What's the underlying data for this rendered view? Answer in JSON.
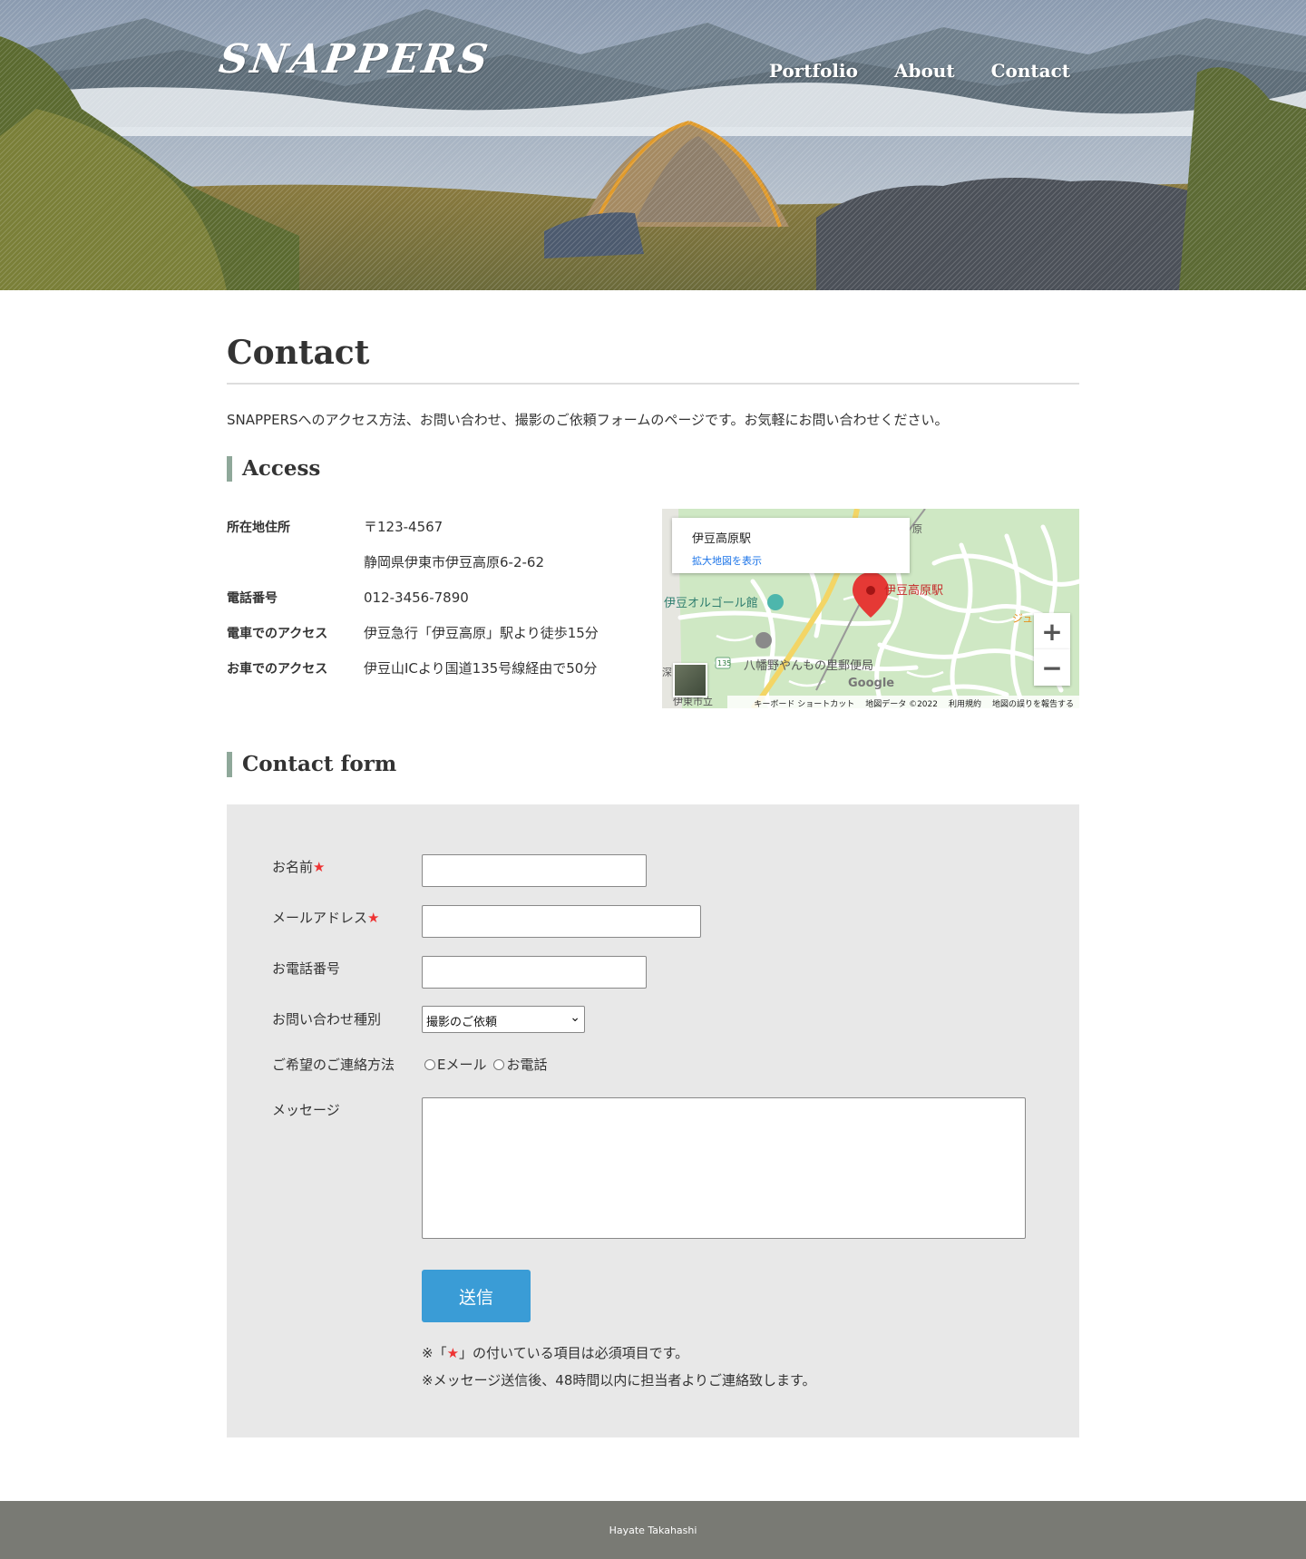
{
  "header": {
    "logo": "SNAPPERS",
    "nav": [
      "Portfolio",
      "About",
      "Contact"
    ]
  },
  "main": {
    "title": "Contact",
    "intro": "SNAPPERSへのアクセス方法、お問い合わせ、撮影のご依頼フォームのページです。お気軽にお問い合わせください。",
    "access": {
      "title": "Access",
      "rows": [
        {
          "key": "所在地住所",
          "value": "〒123-4567"
        },
        {
          "key": "",
          "value": "静岡県伊東市伊豆高原6-2-62"
        },
        {
          "key": "電話番号",
          "value": "012-3456-7890"
        },
        {
          "key": "電車でのアクセス",
          "value": "伊豆急行「伊豆高原」駅より徒歩15分"
        },
        {
          "key": "お車でのアクセス",
          "value": "伊豆山ICより国道135号線経由で50分"
        }
      ],
      "map": {
        "place_title": "伊豆高原駅",
        "place_link": "拡大地図を表示",
        "marker_label": "伊豆高原駅",
        "poi_1": "伊豆オルゴール館",
        "poi_2": "八幡野やんもの里郵便局",
        "poi_3": "伊東市立",
        "poi_4": "ジュ",
        "poi_5": "原",
        "poi_6": "深",
        "road_shield": "135",
        "logo": "Google",
        "zoom_in": "+",
        "zoom_out": "−",
        "footer": [
          "キーボード ショートカット",
          "地図データ ©2022",
          "利用規約",
          "地図の誤りを報告する"
        ]
      }
    },
    "form": {
      "title": "Contact form",
      "req_mark": "★",
      "name_label": "お名前",
      "email_label": "メールアドレス",
      "phone_label": "お電話番号",
      "type_label": "お問い合わせ種別",
      "type_selected": "撮影のご依頼",
      "method_label": "ご希望のご連絡方法",
      "method_options": [
        "Eメール",
        "お電話"
      ],
      "message_label": "メッセージ",
      "submit": "送信",
      "note1_pre": "※「",
      "note1_post": "」の付いている項目は必須項目です。",
      "note2": "※メッセージ送信後、48時間以内に担当者よりご連絡致します。"
    }
  },
  "footer": {
    "text": "Hayate Takahashi"
  }
}
